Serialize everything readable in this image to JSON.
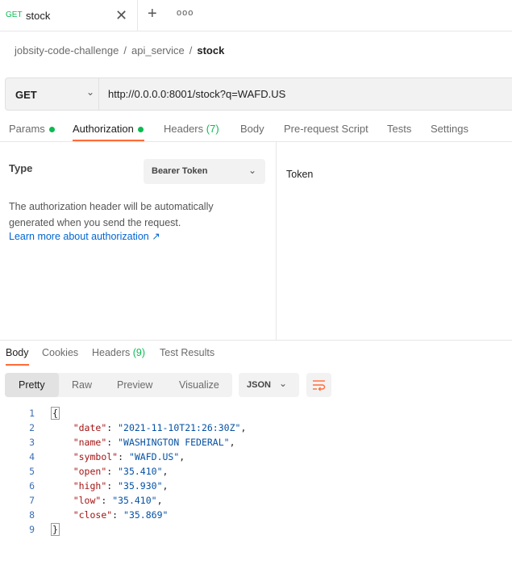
{
  "tab": {
    "method": "GET",
    "name": "stock",
    "close": "✕",
    "add": "+",
    "more": "ooo"
  },
  "breadcrumb": {
    "items": [
      "jobsity-code-challenge",
      "api_service"
    ],
    "current": "stock",
    "sep": "/"
  },
  "request": {
    "method": "GET",
    "url": "http://0.0.0.0:8001/stock?q=WAFD.US"
  },
  "req_tabs": {
    "params": "Params",
    "authorization": "Authorization",
    "headers": "Headers",
    "headers_count": "(7)",
    "body": "Body",
    "prerequest": "Pre-request Script",
    "tests": "Tests",
    "settings": "Settings"
  },
  "auth": {
    "type_label": "Type",
    "type_value": "Bearer Token",
    "description": "The authorization header will be automatically generated when you send the request.",
    "learn_more": "Learn more about authorization ↗",
    "token_label": "Token"
  },
  "res_tabs": {
    "body": "Body",
    "cookies": "Cookies",
    "headers": "Headers",
    "headers_count": "(9)",
    "test_results": "Test Results"
  },
  "view": {
    "pretty": "Pretty",
    "raw": "Raw",
    "preview": "Preview",
    "visualize": "Visualize",
    "format": "JSON"
  },
  "code_lines": [
    {
      "n": "1",
      "open": "{"
    },
    {
      "n": "2",
      "key": "\"date\"",
      "val": "\"2021-11-10T21:26:30Z\"",
      "end": ","
    },
    {
      "n": "3",
      "key": "\"name\"",
      "val": "\"WASHINGTON FEDERAL\"",
      "end": ","
    },
    {
      "n": "4",
      "key": "\"symbol\"",
      "val": "\"WAFD.US\"",
      "end": ","
    },
    {
      "n": "5",
      "key": "\"open\"",
      "val": "\"35.410\"",
      "end": ","
    },
    {
      "n": "6",
      "key": "\"high\"",
      "val": "\"35.930\"",
      "end": ","
    },
    {
      "n": "7",
      "key": "\"low\"",
      "val": "\"35.410\"",
      "end": ","
    },
    {
      "n": "8",
      "key": "\"close\"",
      "val": "\"35.869\"",
      "end": ""
    },
    {
      "n": "9",
      "open": "}"
    }
  ],
  "colors": {
    "accent": "#ff6c37",
    "get": "#0cbb52",
    "link": "#0265d2"
  }
}
